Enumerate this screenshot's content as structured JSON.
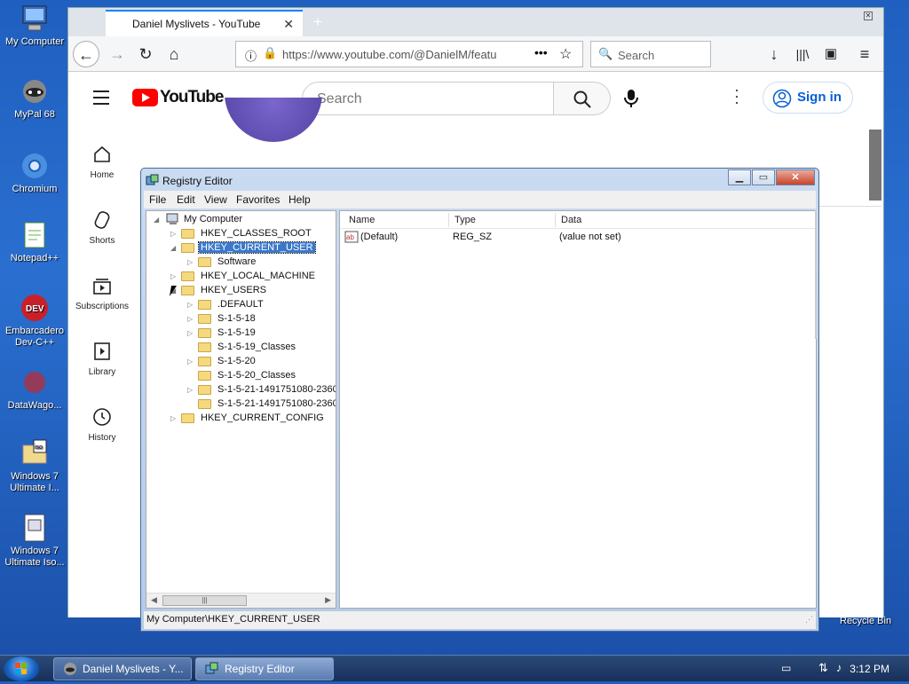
{
  "desktop": {
    "icons": [
      {
        "label": "My Computer"
      },
      {
        "label": "MyPal 68"
      },
      {
        "label": "Chromium"
      },
      {
        "label": "Notepad++"
      },
      {
        "label": "Embarcadero Dev-C++"
      },
      {
        "label": "DataWago..."
      },
      {
        "label": "Windows 7 Ultimate I..."
      },
      {
        "label": "Windows 7 Ultimate Iso..."
      }
    ],
    "recycle_bin": "Recycle Bin"
  },
  "browser": {
    "tab_title": "Daniel Myslivets - YouTube",
    "url": "https://www.youtube.com/@DanielM/featu",
    "search_placeholder": "Search",
    "youtube": {
      "logo_text": "YouTube",
      "search_placeholder": "Search",
      "sign_in": "Sign in",
      "sidebar": [
        {
          "label": "Home"
        },
        {
          "label": "Shorts"
        },
        {
          "label": "Subscriptions"
        },
        {
          "label": "Library"
        },
        {
          "label": "History"
        }
      ]
    }
  },
  "regedit": {
    "title": "Registry Editor",
    "menu": [
      "File",
      "Edit",
      "View",
      "Favorites",
      "Help"
    ],
    "tree": [
      {
        "label": "My Computer",
        "depth": 0
      },
      {
        "label": "HKEY_CLASSES_ROOT",
        "depth": 1
      },
      {
        "label": "HKEY_CURRENT_USER",
        "depth": 1,
        "selected": true
      },
      {
        "label": "Software",
        "depth": 2
      },
      {
        "label": "HKEY_LOCAL_MACHINE",
        "depth": 1
      },
      {
        "label": "HKEY_USERS",
        "depth": 1
      },
      {
        "label": ".DEFAULT",
        "depth": 2
      },
      {
        "label": "S-1-5-18",
        "depth": 2
      },
      {
        "label": "S-1-5-19",
        "depth": 2
      },
      {
        "label": "S-1-5-19_Classes",
        "depth": 2
      },
      {
        "label": "S-1-5-20",
        "depth": 2
      },
      {
        "label": "S-1-5-20_Classes",
        "depth": 2
      },
      {
        "label": "S-1-5-21-1491751080-2360",
        "depth": 2
      },
      {
        "label": "S-1-5-21-1491751080-2360",
        "depth": 2
      },
      {
        "label": "HKEY_CURRENT_CONFIG",
        "depth": 1
      }
    ],
    "columns": [
      "Name",
      "Type",
      "Data"
    ],
    "values": [
      {
        "name": "(Default)",
        "type": "REG_SZ",
        "data": "(value not set)"
      }
    ],
    "status": "My Computer\\HKEY_CURRENT_USER"
  },
  "taskbar": {
    "items": [
      {
        "label": "Daniel Myslivets - Y..."
      },
      {
        "label": "Registry Editor"
      }
    ],
    "time": "3:12 PM"
  }
}
